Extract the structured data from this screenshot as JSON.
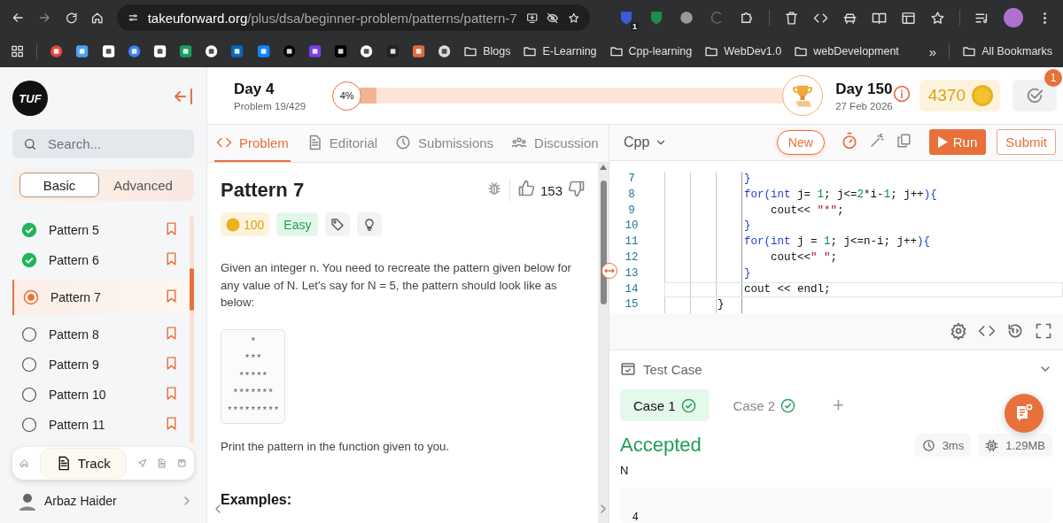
{
  "browser": {
    "url_host": "takeuforward.org",
    "url_path": "/plus/dsa/beginner-problem/patterns/pattern-7",
    "extension_badge": "1",
    "bookmarks": [
      {
        "label": "Blogs"
      },
      {
        "label": "E-Learning"
      },
      {
        "label": "Cpp-learning"
      },
      {
        "label": "WebDev1.0"
      },
      {
        "label": "webDevelopment"
      }
    ],
    "more": "»",
    "all_bookmarks": "All Bookmarks"
  },
  "sidebar": {
    "logo": "TUF",
    "search": {
      "placeholder": "Search..."
    },
    "modes": [
      {
        "label": "Basic",
        "selected": true
      },
      {
        "label": "Advanced",
        "selected": false
      }
    ],
    "problems": [
      {
        "label": "Pattern 5",
        "kind": "solved",
        "selected": false
      },
      {
        "label": "Pattern 6",
        "kind": "solved",
        "selected": false
      },
      {
        "label": "Pattern 7",
        "kind": "current",
        "selected": true
      },
      {
        "label": "Pattern 8",
        "kind": "todo",
        "selected": false
      },
      {
        "label": "Pattern 9",
        "kind": "todo",
        "selected": false
      },
      {
        "label": "Pattern 10",
        "kind": "todo",
        "selected": false
      },
      {
        "label": "Pattern 11",
        "kind": "todo",
        "selected": false
      }
    ],
    "dock": {
      "track": "Track"
    },
    "user": {
      "name": "Arbaz Haider"
    }
  },
  "header": {
    "day": "Day 4",
    "problem_count": "Problem 19/429",
    "progress": {
      "label": "4%",
      "level": 0.04
    },
    "goal_day": "Day 150",
    "goal_date": "27 Feb 2026",
    "coins": "4370",
    "notifications": "1"
  },
  "problem": {
    "tabs": [
      {
        "label": "Problem",
        "kind": "code",
        "selected": true
      },
      {
        "label": "Editorial",
        "kind": "doc",
        "selected": false
      },
      {
        "label": "Submissions",
        "kind": "clock",
        "selected": false
      },
      {
        "label": "Discussion",
        "kind": "people",
        "selected": false
      }
    ],
    "title": "Pattern 7",
    "likes": "153",
    "coins": "100",
    "difficulty": "Easy",
    "description": "Given an integer n. You need to recreate the pattern given below for any value of N. Let's say for N = 5, the pattern should look like as below:",
    "pattern": "*\n***\n*****\n*******\n*********",
    "note": "Print the pattern in the function given to you.",
    "examples_heading": "Examples:"
  },
  "editor": {
    "language": "Cpp",
    "new_button": "New",
    "run": "Run",
    "submit": "Submit",
    "lines": [
      {
        "number": "7",
        "current": false,
        "tokens": [
          {
            "text": "            }",
            "kind": "keyword"
          }
        ]
      },
      {
        "number": "8",
        "current": false,
        "tokens": [
          {
            "text": "            for(",
            "kind": "keyword"
          },
          {
            "text": "int",
            "kind": "keyword"
          },
          {
            "text": " j= ",
            "kind": "plain"
          },
          {
            "text": "1",
            "kind": "number"
          },
          {
            "text": "; j<=",
            "kind": "plain"
          },
          {
            "text": "2",
            "kind": "number"
          },
          {
            "text": "*i-",
            "kind": "plain"
          },
          {
            "text": "1",
            "kind": "number"
          },
          {
            "text": "; j++",
            "kind": "plain"
          },
          {
            "text": "){",
            "kind": "keyword"
          }
        ]
      },
      {
        "number": "9",
        "current": false,
        "tokens": [
          {
            "text": "                cout<< ",
            "kind": "plain"
          },
          {
            "text": "\"*\"",
            "kind": "string"
          },
          {
            "text": ";",
            "kind": "plain"
          }
        ]
      },
      {
        "number": "10",
        "current": false,
        "tokens": [
          {
            "text": "            }",
            "kind": "keyword"
          }
        ]
      },
      {
        "number": "11",
        "current": false,
        "tokens": [
          {
            "text": "            for(",
            "kind": "keyword"
          },
          {
            "text": "int",
            "kind": "keyword"
          },
          {
            "text": " j = ",
            "kind": "plain"
          },
          {
            "text": "1",
            "kind": "number"
          },
          {
            "text": "; j<=n-i; j++",
            "kind": "plain"
          },
          {
            "text": "){",
            "kind": "keyword"
          }
        ]
      },
      {
        "number": "12",
        "current": false,
        "tokens": [
          {
            "text": "                cout<<",
            "kind": "plain"
          },
          {
            "text": "\" \"",
            "kind": "string"
          },
          {
            "text": ";",
            "kind": "plain"
          }
        ]
      },
      {
        "number": "13",
        "current": false,
        "tokens": [
          {
            "text": "            }",
            "kind": "keyword"
          }
        ]
      },
      {
        "number": "14",
        "current": true,
        "tokens": [
          {
            "text": "            cout << endl;",
            "kind": "plain"
          }
        ]
      },
      {
        "number": "15",
        "current": false,
        "tokens": [
          {
            "text": "        }",
            "kind": "plain"
          }
        ]
      }
    ],
    "test": {
      "title": "Test Case",
      "cases": [
        {
          "label": "Case 1",
          "selected": true,
          "passed": true
        },
        {
          "label": "Case 2",
          "selected": false,
          "passed": true
        }
      ],
      "add": "+",
      "verdict": "Accepted",
      "time": "3ms",
      "memory": "1.29MB",
      "input_label": "N",
      "input_value": "4"
    }
  }
}
